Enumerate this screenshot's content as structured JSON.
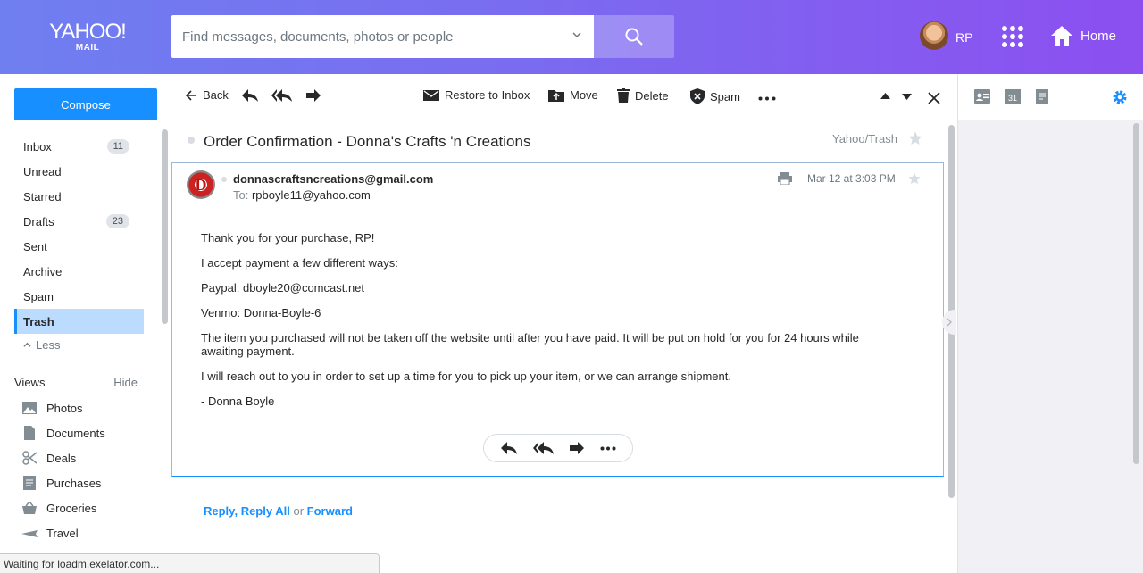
{
  "header": {
    "logo_main": "YAHOO!",
    "logo_sub": "MAIL",
    "search_placeholder": "Find messages, documents, photos or people",
    "user_initials": "RP",
    "home_label": "Home"
  },
  "sidebar": {
    "compose_label": "Compose",
    "folders": [
      {
        "label": "Inbox",
        "count": "11"
      },
      {
        "label": "Unread",
        "count": ""
      },
      {
        "label": "Starred",
        "count": ""
      },
      {
        "label": "Drafts",
        "count": "23"
      },
      {
        "label": "Sent",
        "count": ""
      },
      {
        "label": "Archive",
        "count": ""
      },
      {
        "label": "Spam",
        "count": ""
      },
      {
        "label": "Trash",
        "count": ""
      }
    ],
    "less_label": "Less",
    "views_label": "Views",
    "hide_label": "Hide",
    "views": [
      {
        "label": "Photos",
        "icon": "photo-icon"
      },
      {
        "label": "Documents",
        "icon": "document-icon"
      },
      {
        "label": "Deals",
        "icon": "scissors-icon"
      },
      {
        "label": "Purchases",
        "icon": "receipt-icon"
      },
      {
        "label": "Groceries",
        "icon": "basket-icon"
      },
      {
        "label": "Travel",
        "icon": "plane-icon"
      }
    ]
  },
  "toolbar": {
    "back_label": "Back",
    "restore_label": "Restore to Inbox",
    "move_label": "Move",
    "delete_label": "Delete",
    "spam_label": "Spam"
  },
  "message": {
    "subject": "Order Confirmation - Donna's Crafts 'n Creations",
    "folder_tag": "Yahoo/Trash",
    "sender": "donnascraftsncreations@gmail.com",
    "to_label": "To:",
    "to_address": "rpboyle11@yahoo.com",
    "date": "Mar 12 at 3:03 PM",
    "avatar_letter": "D",
    "body": [
      "Thank you for your purchase, RP!",
      "I accept payment a few different ways:",
      "Paypal: dboyle20@comcast.net",
      "Venmo: Donna-Boyle-6",
      "The item you purchased will not be taken off the website until after you have paid. It will be put on hold for you for 24 hours while awaiting payment.",
      "I will reach out to you in order to set up a time for you to pick up your item, or we can arrange shipment.",
      "- Donna Boyle"
    ]
  },
  "reply_links": {
    "reply": "Reply",
    "comma": ",",
    "reply_all": "Reply All",
    "or": "or",
    "forward": "Forward"
  },
  "status_bar": "Waiting for loadm.exelator.com...",
  "colors": {
    "accent": "#188fff",
    "header_gradient_start": "#6f7ff0",
    "header_gradient_end": "#8c4ff0",
    "active_folder_bg": "#bcdcff"
  }
}
